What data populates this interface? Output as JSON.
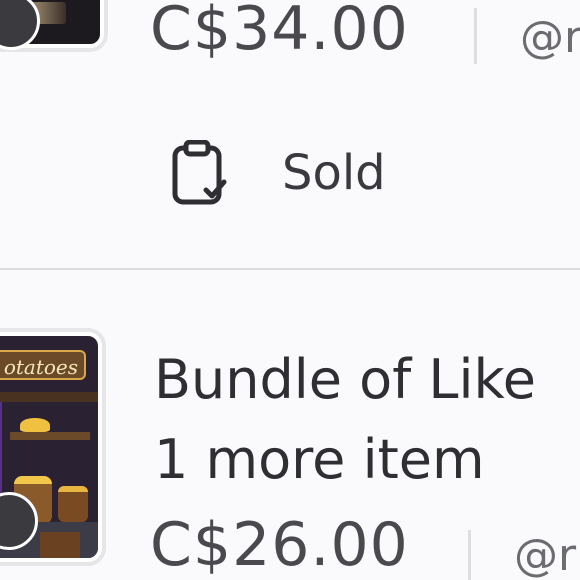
{
  "listings": [
    {
      "price": "C$34.00",
      "seller": "@r",
      "status": {
        "label": "Sold",
        "icon": "clipboard-check-icon"
      }
    },
    {
      "thumbnail_sign": "otatoes",
      "title_line1": "Bundle of Like",
      "title_line2": "1 more item",
      "price": "C$26.00",
      "seller": "@r"
    }
  ],
  "colors": {
    "background": "#faf9fb",
    "text_primary": "#2f2f33",
    "text_price": "#4a4a4e",
    "divider": "#dcdbde",
    "badge": "#3b3b3f"
  }
}
